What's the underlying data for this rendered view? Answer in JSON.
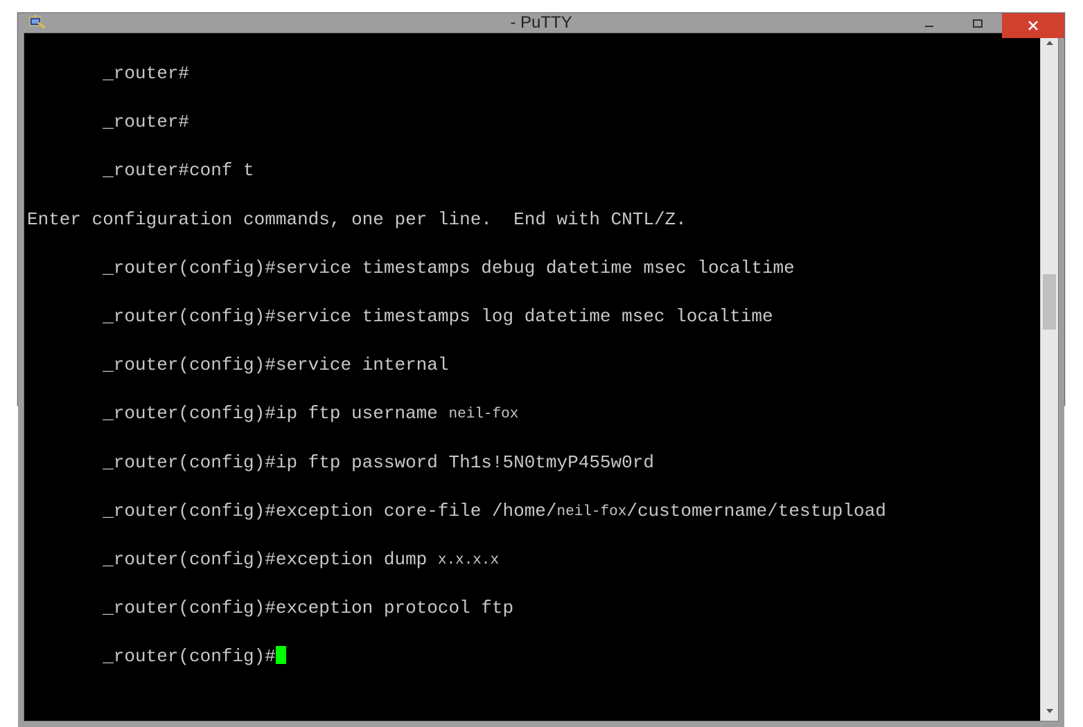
{
  "window": {
    "title": "- PuTTY"
  },
  "terminal": {
    "prompt_user": "_router#",
    "prompt_config": "_router(config)#",
    "lines": {
      "l0": "_router#",
      "l1": "_router#",
      "l2p": "_router#",
      "l2c": "conf t",
      "l3": "Enter configuration commands, one per line.  End with CNTL/Z.",
      "l4p": "_router(config)#",
      "l4c": "service timestamps debug datetime msec localtime",
      "l5p": "_router(config)#",
      "l5c": "service timestamps log datetime msec localtime",
      "l6p": "_router(config)#",
      "l6c": "service internal",
      "l7p": "_router(config)#",
      "l7c": "ip ftp username ",
      "l7r": "neil-fox",
      "l8p": "_router(config)#",
      "l8c": "ip ftp password Th1s!5N0tmyP455w0rd",
      "l9p": "_router(config)#",
      "l9c": "exception core-file /home/",
      "l9r": "neil-fox",
      "l9d": "/customername/testupload",
      "l10p": "_router(config)#",
      "l10c": "exception dump ",
      "l10r": "x.x.x.x",
      "l11p": "_router(config)#",
      "l11c": "exception protocol ftp",
      "l12p": "_router(config)#"
    }
  }
}
